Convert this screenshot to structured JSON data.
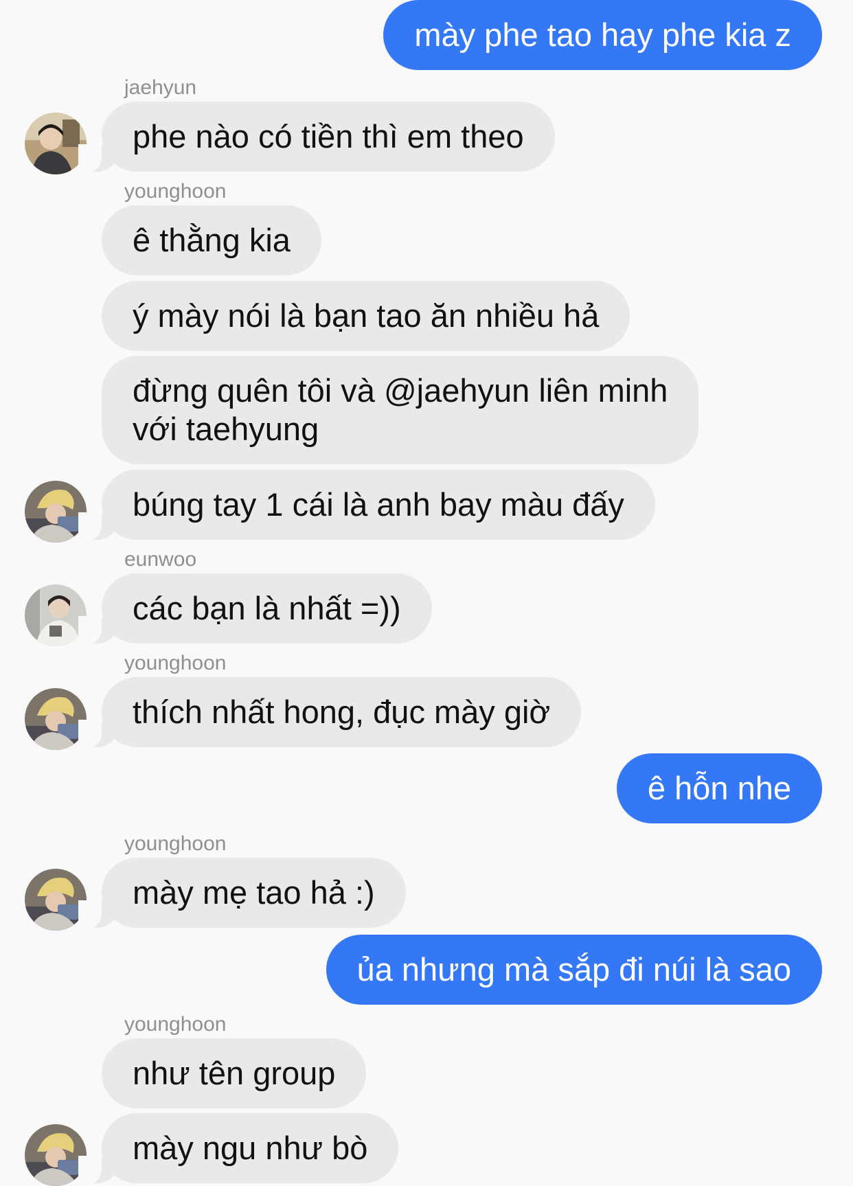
{
  "chat": {
    "m1": "mày phe tao hay phe kia z",
    "s1": "jaehyun",
    "m2": "phe nào có tiền thì em theo",
    "s2": "younghoon",
    "m3": "ê thằng kia",
    "m4": "ý mày nói là bạn tao ăn nhiều hả",
    "m5": "đừng quên tôi và @jaehyun liên minh\nvới taehyung",
    "m6": "búng tay 1 cái là anh bay màu đấy",
    "s3": "eunwoo",
    "m7": "các bạn là nhất =))",
    "s4": "younghoon",
    "m8": "thích nhất hong, đục mày giờ",
    "m9": "ê hỗn nhe",
    "s5": "younghoon",
    "m10": "mày mẹ tao hả :)",
    "m11": "ủa nhưng mà sắp đi núi là sao",
    "s6": "younghoon",
    "m12": "như tên group",
    "m13": "mày ngu như bò"
  }
}
